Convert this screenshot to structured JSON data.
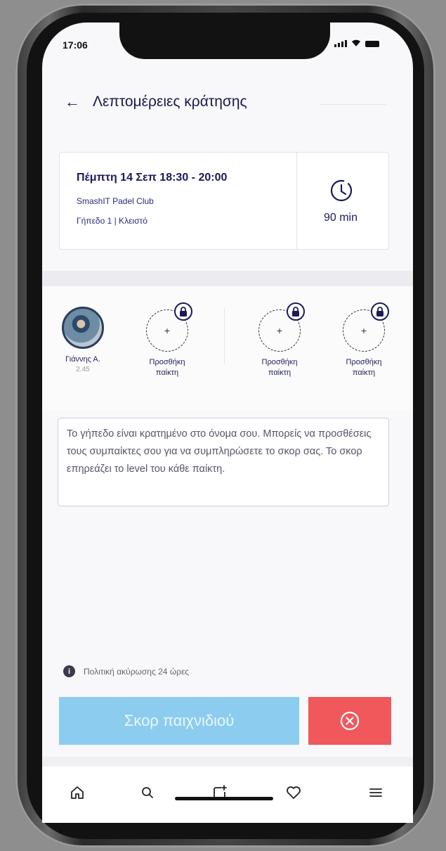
{
  "status_bar": {
    "time": "17:06"
  },
  "header": {
    "title": "Λεπτομέρειες κράτησης"
  },
  "booking": {
    "date_time": "Πέμπτη 14 Σεπ 18:30 - 20:00",
    "club": "SmashIT Padel Club",
    "court": "Γήπεδο 1 | Κλειστό",
    "duration": "90 min"
  },
  "players": [
    {
      "name": "Γιάννης Α.",
      "level": "2.45",
      "type": "avatar"
    },
    {
      "name": "Προσθήκη παίκτη",
      "type": "add",
      "locked": true
    },
    {
      "name": "Προσθήκη παίκτη",
      "type": "add",
      "locked": true
    },
    {
      "name": "Προσθήκη παίκτη",
      "type": "add",
      "locked": true
    }
  ],
  "info_text": "Το γήπεδο είναι κρατημένο στο όνομα σου. Μπορείς να προσθέσεις τους συμπαίκτες σου για να συμπληρώσετε το σκορ σας. Το σκορ επηρεάζει το level του κάθε παίκτη.",
  "cancellation_policy": "Πολιτική ακύρωσης 24 ώρες",
  "actions": {
    "score_label": "Σκορ παιχνιδιού",
    "cancel_icon": "close-circle-icon"
  },
  "nav": [
    "home-icon",
    "search-icon",
    "add-post-icon",
    "heart-icon",
    "menu-icon"
  ],
  "colors": {
    "primary_text": "#1b1a5a",
    "score_button": "#8ccdef",
    "cancel_button": "#f0585b"
  }
}
